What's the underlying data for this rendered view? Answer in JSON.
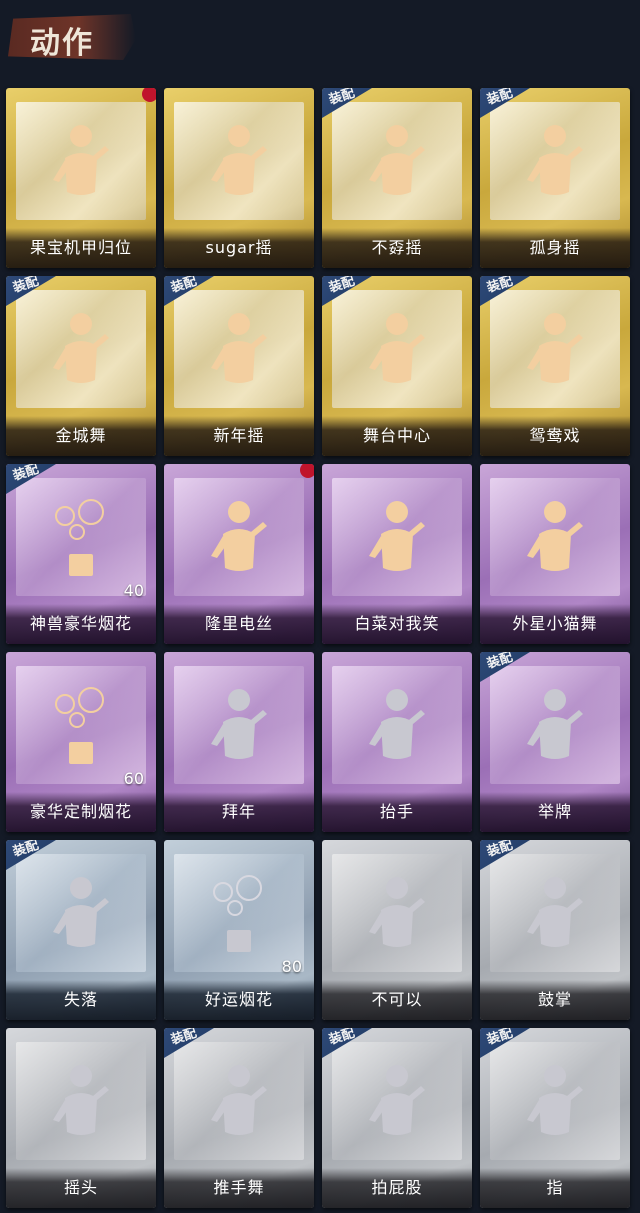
{
  "header": {
    "title": "动作"
  },
  "badge_text": "装配",
  "items": [
    {
      "label": "果宝机甲归位",
      "tier": "gold",
      "equipped": false,
      "new": true,
      "icon": "dance-figure-icon"
    },
    {
      "label": "sugar摇",
      "tier": "gold",
      "equipped": false,
      "new": false,
      "icon": "dance-figure-icon"
    },
    {
      "label": "不孬摇",
      "tier": "gold",
      "equipped": true,
      "new": false,
      "icon": "dance-figure-icon"
    },
    {
      "label": "孤身摇",
      "tier": "gold",
      "equipped": true,
      "new": false,
      "icon": "dance-figure-icon"
    },
    {
      "label": "金城舞",
      "tier": "gold",
      "equipped": true,
      "new": false,
      "icon": "dance-figure-icon"
    },
    {
      "label": "新年摇",
      "tier": "gold",
      "equipped": true,
      "new": false,
      "icon": "dance-figure-icon"
    },
    {
      "label": "舞台中心",
      "tier": "gold",
      "equipped": true,
      "new": false,
      "icon": "dance-figure-icon"
    },
    {
      "label": "鸳鸯戏",
      "tier": "gold",
      "equipped": true,
      "new": false,
      "icon": "dance-figure-icon"
    },
    {
      "label": "神兽豪华烟花",
      "tier": "purple",
      "equipped": true,
      "new": false,
      "icon": "firework-box-icon",
      "count": "40"
    },
    {
      "label": "隆里电丝",
      "tier": "purple",
      "equipped": false,
      "new": true,
      "icon": "dance-figure-icon"
    },
    {
      "label": "白菜对我笑",
      "tier": "purple",
      "equipped": false,
      "new": false,
      "icon": "dance-figure-icon"
    },
    {
      "label": "外星小猫舞",
      "tier": "purple",
      "equipped": false,
      "new": false,
      "icon": "dance-figure-icon"
    },
    {
      "label": "豪华定制烟花",
      "tier": "purple",
      "equipped": false,
      "new": false,
      "icon": "firework-box-icon",
      "count": "60"
    },
    {
      "label": "拜年",
      "tier": "purple",
      "equipped": false,
      "new": false,
      "icon": "greeting-figure-icon"
    },
    {
      "label": "抬手",
      "tier": "purple",
      "equipped": false,
      "new": false,
      "icon": "raise-hand-figure-icon"
    },
    {
      "label": "举牌",
      "tier": "purple",
      "equipped": true,
      "new": false,
      "icon": "hold-sign-figure-icon"
    },
    {
      "label": "失落",
      "tier": "blue",
      "equipped": true,
      "new": false,
      "icon": "kneeling-figure-icon"
    },
    {
      "label": "好运烟花",
      "tier": "blue",
      "equipped": false,
      "new": false,
      "icon": "firework-tube-icon",
      "count": "80"
    },
    {
      "label": "不可以",
      "tier": "silver",
      "equipped": false,
      "new": false,
      "icon": "finger-wag-icon"
    },
    {
      "label": "鼓掌",
      "tier": "silver",
      "equipped": true,
      "new": false,
      "icon": "clapping-hands-icon"
    },
    {
      "label": "摇头",
      "tier": "silver",
      "equipped": false,
      "new": false,
      "icon": "head-shake-figure-icon"
    },
    {
      "label": "推手舞",
      "tier": "silver",
      "equipped": true,
      "new": false,
      "icon": "push-hand-figure-icon"
    },
    {
      "label": "拍屁股",
      "tier": "silver",
      "equipped": true,
      "new": false,
      "icon": "butt-slap-figure-icon"
    },
    {
      "label": "指",
      "tier": "silver",
      "equipped": true,
      "new": false,
      "icon": "pointing-hand-icon"
    }
  ]
}
